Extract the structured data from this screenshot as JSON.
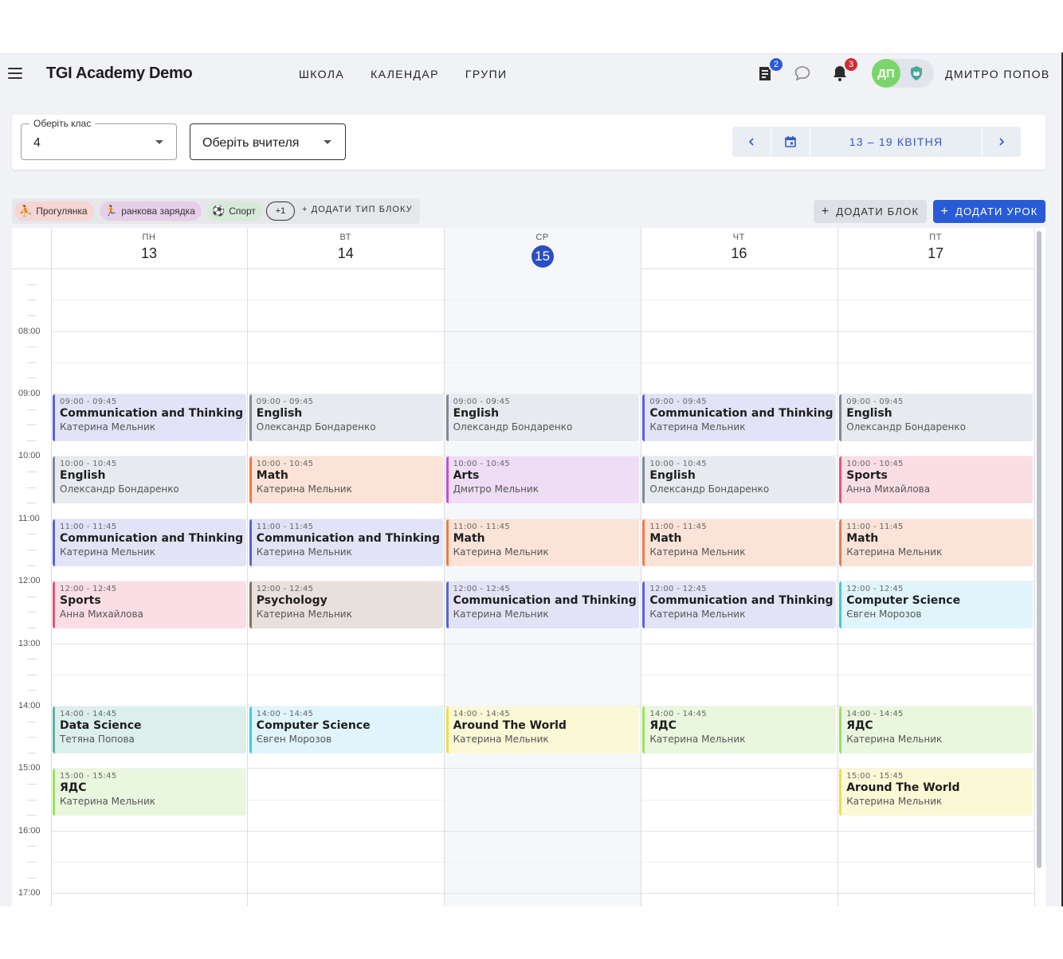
{
  "app": {
    "title": "TGI Academy Demo",
    "nav": [
      "ШКОЛА",
      "КАЛЕНДАР",
      "ГРУПИ"
    ],
    "user_name": "ДМИТРО ПОПОВ",
    "avatar_initials": "ДП",
    "tasks_badge": "2",
    "notifications_badge": "3"
  },
  "filters": {
    "class_label": "Оберіть клас",
    "class_value": "4",
    "teacher_placeholder": "Оберіть вчителя",
    "date_range": "13 – 19 КВІТНЯ"
  },
  "chips": [
    {
      "label": "Прогулянка",
      "icon": "basketball-icon",
      "color": "#f6d5d2"
    },
    {
      "label": "ранкова зарядка",
      "icon": "exercise-icon",
      "color": "#e6cfe8"
    },
    {
      "label": "Спорт",
      "icon": "soccer-icon",
      "color": "#d5ead7"
    }
  ],
  "chips_more": "+1",
  "add_block_type": "ДОДАТИ ТИП БЛОКУ",
  "add_block": "ДОДАТИ БЛОК",
  "add_lesson": "ДОДАТИ УРОК",
  "days": [
    {
      "dow": "ПН",
      "num": "13",
      "today": false
    },
    {
      "dow": "ВТ",
      "num": "14",
      "today": false
    },
    {
      "dow": "СР",
      "num": "15",
      "today": true
    },
    {
      "dow": "ЧТ",
      "num": "16",
      "today": false
    },
    {
      "dow": "ПТ",
      "num": "17",
      "today": false
    }
  ],
  "hours": [
    "08:00",
    "09:00",
    "10:00",
    "11:00",
    "12:00",
    "13:00",
    "14:00",
    "15:00",
    "16:00",
    "17:00"
  ],
  "events": [
    {
      "day": 0,
      "start": 9,
      "time": "09:00 - 09:45",
      "subject": "Communication and Thinking",
      "teacher": "Катерина Мельник",
      "bg": "#e3e3f7",
      "border": "#5b62d6"
    },
    {
      "day": 0,
      "start": 10,
      "time": "10:00 - 10:45",
      "subject": "English",
      "teacher": "Олександр Бондаренко",
      "bg": "#e7eaee",
      "border": "#7d8a96"
    },
    {
      "day": 0,
      "start": 11,
      "time": "11:00 - 11:45",
      "subject": "Communication and Thinking",
      "teacher": "Катерина Мельник",
      "bg": "#e3e3f7",
      "border": "#5b62d6"
    },
    {
      "day": 0,
      "start": 12,
      "time": "12:00 - 12:45",
      "subject": "Sports",
      "teacher": "Анна Михайлова",
      "bg": "#fadde5",
      "border": "#e5527a"
    },
    {
      "day": 0,
      "start": 14,
      "time": "14:00 - 14:45",
      "subject": "Data Science",
      "teacher": "Тетяна Попова",
      "bg": "#dcefec",
      "border": "#5fb3a3"
    },
    {
      "day": 0,
      "start": 15,
      "time": "15:00 - 15:45",
      "subject": "ЯДС",
      "teacher": "Катерина Мельник",
      "bg": "#eaf7df",
      "border": "#9be05b"
    },
    {
      "day": 1,
      "start": 9,
      "time": "09:00 - 09:45",
      "subject": "English",
      "teacher": "Олександр Бондаренко",
      "bg": "#e7eaee",
      "border": "#7d8a96"
    },
    {
      "day": 1,
      "start": 10,
      "time": "10:00 - 10:45",
      "subject": "Math",
      "teacher": "Катерина Мельник",
      "bg": "#fbe3d7",
      "border": "#ee7a45"
    },
    {
      "day": 1,
      "start": 11,
      "time": "11:00 - 11:45",
      "subject": "Communication and Thinking",
      "teacher": "Катерина Мельник",
      "bg": "#e3e3f7",
      "border": "#5b62d6"
    },
    {
      "day": 1,
      "start": 12,
      "time": "12:00 - 12:45",
      "subject": "Psychology",
      "teacher": "Катерина Мельник",
      "bg": "#e7e0dc",
      "border": "#8a7060"
    },
    {
      "day": 1,
      "start": 14,
      "time": "14:00 - 14:45",
      "subject": "Computer Science",
      "teacher": "Євген Морозов",
      "bg": "#dff5fb",
      "border": "#45c6e8"
    },
    {
      "day": 2,
      "start": 9,
      "time": "09:00 - 09:45",
      "subject": "English",
      "teacher": "Олександр Бондаренко",
      "bg": "#e7eaee",
      "border": "#7d8a96"
    },
    {
      "day": 2,
      "start": 10,
      "time": "10:00 - 10:45",
      "subject": "Arts",
      "teacher": "Дмитро Мельник",
      "bg": "#efdcf5",
      "border": "#c04fd6"
    },
    {
      "day": 2,
      "start": 11,
      "time": "11:00 - 11:45",
      "subject": "Math",
      "teacher": "Катерина Мельник",
      "bg": "#fbe3d7",
      "border": "#ee7a45"
    },
    {
      "day": 2,
      "start": 12,
      "time": "12:00 - 12:45",
      "subject": "Communication and Thinking",
      "teacher": "Катерина Мельник",
      "bg": "#e3e3f7",
      "border": "#5b62d6"
    },
    {
      "day": 2,
      "start": 14,
      "time": "14:00 - 14:45",
      "subject": "Around The World",
      "teacher": "Катерина Мельник",
      "bg": "#fbf8d6",
      "border": "#ecdf4a"
    },
    {
      "day": 3,
      "start": 9,
      "time": "09:00 - 09:45",
      "subject": "Communication and Thinking",
      "teacher": "Катерина Мельник",
      "bg": "#e3e3f7",
      "border": "#5b62d6"
    },
    {
      "day": 3,
      "start": 10,
      "time": "10:00 - 10:45",
      "subject": "English",
      "teacher": "Олександр Бондаренко",
      "bg": "#e7eaee",
      "border": "#7d8a96"
    },
    {
      "day": 3,
      "start": 11,
      "time": "11:00 - 11:45",
      "subject": "Math",
      "teacher": "Катерина Мельник",
      "bg": "#fbe3d7",
      "border": "#ee7a45"
    },
    {
      "day": 3,
      "start": 12,
      "time": "12:00 - 12:45",
      "subject": "Communication and Thinking",
      "teacher": "Катерина Мельник",
      "bg": "#e3e3f7",
      "border": "#5b62d6"
    },
    {
      "day": 3,
      "start": 14,
      "time": "14:00 - 14:45",
      "subject": "ЯДС",
      "teacher": "Катерина Мельник",
      "bg": "#eaf7df",
      "border": "#9be05b"
    },
    {
      "day": 4,
      "start": 9,
      "time": "09:00 - 09:45",
      "subject": "English",
      "teacher": "Олександр Бондаренко",
      "bg": "#e7eaee",
      "border": "#7d8a96"
    },
    {
      "day": 4,
      "start": 10,
      "time": "10:00 - 10:45",
      "subject": "Sports",
      "teacher": "Анна Михайлова",
      "bg": "#fadde5",
      "border": "#e5527a"
    },
    {
      "day": 4,
      "start": 11,
      "time": "11:00 - 11:45",
      "subject": "Math",
      "teacher": "Катерина Мельник",
      "bg": "#fbe3d7",
      "border": "#ee7a45"
    },
    {
      "day": 4,
      "start": 12,
      "time": "12:00 - 12:45",
      "subject": "Computer Science",
      "teacher": "Євген Морозов",
      "bg": "#dff5fb",
      "border": "#45c6e8"
    },
    {
      "day": 4,
      "start": 14,
      "time": "14:00 - 14:45",
      "subject": "ЯДС",
      "teacher": "Катерина Мельник",
      "bg": "#eaf7df",
      "border": "#9be05b"
    },
    {
      "day": 4,
      "start": 15,
      "time": "15:00 - 15:45",
      "subject": "Around The World",
      "teacher": "Катерина Мельник",
      "bg": "#fbf8d6",
      "border": "#ecdf4a"
    }
  ],
  "colors": {
    "accent": "#2a5bd7",
    "today_column": "#f5f7fb"
  }
}
